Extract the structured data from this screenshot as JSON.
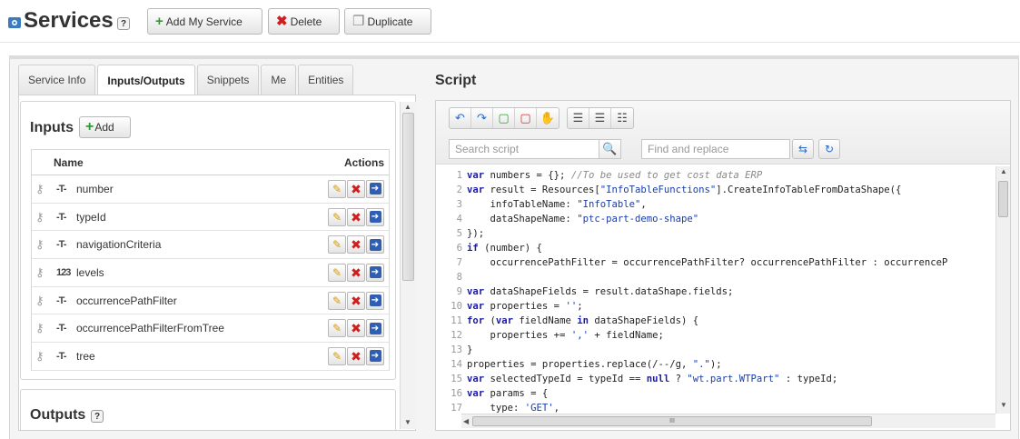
{
  "header": {
    "title": "Services",
    "help": "?",
    "buttons": {
      "add": "Add My Service",
      "delete": "Delete",
      "duplicate": "Duplicate"
    }
  },
  "tabs": [
    {
      "label": "Service Info",
      "active": false
    },
    {
      "label": "Inputs/Outputs",
      "active": true
    },
    {
      "label": "Snippets",
      "active": false
    },
    {
      "label": "Me",
      "active": false
    },
    {
      "label": "Entities",
      "active": false
    }
  ],
  "inputs": {
    "title": "Inputs",
    "add_label": "Add",
    "columns": {
      "name": "Name",
      "actions": "Actions"
    },
    "rows": [
      {
        "type": "-T-",
        "name": "number"
      },
      {
        "type": "-T-",
        "name": "typeId"
      },
      {
        "type": "-T-",
        "name": "navigationCriteria"
      },
      {
        "type": "123",
        "name": "levels"
      },
      {
        "type": "-T-",
        "name": "occurrencePathFilter"
      },
      {
        "type": "-T-",
        "name": "occurrencePathFilterFromTree"
      },
      {
        "type": "-T-",
        "name": "tree"
      }
    ]
  },
  "outputs": {
    "title": "Outputs",
    "help": "?"
  },
  "script": {
    "title": "Script",
    "search_placeholder": "Search script",
    "replace_placeholder": "Find and replace",
    "lines": [
      "var numbers = {}; //To be used to get cost data ERP",
      "var result = Resources[\"InfoTableFunctions\"].CreateInfoTableFromDataShape({",
      "    infoTableName: \"InfoTable\",",
      "    dataShapeName: \"ptc-part-demo-shape\"",
      "});",
      "if (number) {",
      "    occurrencePathFilter = occurrencePathFilter? occurrencePathFilter : occurrenceP",
      "",
      "var dataShapeFields = result.dataShape.fields;",
      "var properties = '';",
      "for (var fieldName in dataShapeFields) {",
      "    properties += ',' + fieldName;",
      "}",
      "properties = properties.replace(/--/g, \".\");",
      "var selectedTypeId = typeId == null ? \"wt.part.WTPart\" : typeId;",
      "var params = {",
      "    type: 'GET',"
    ],
    "scroll_grip": "III"
  }
}
